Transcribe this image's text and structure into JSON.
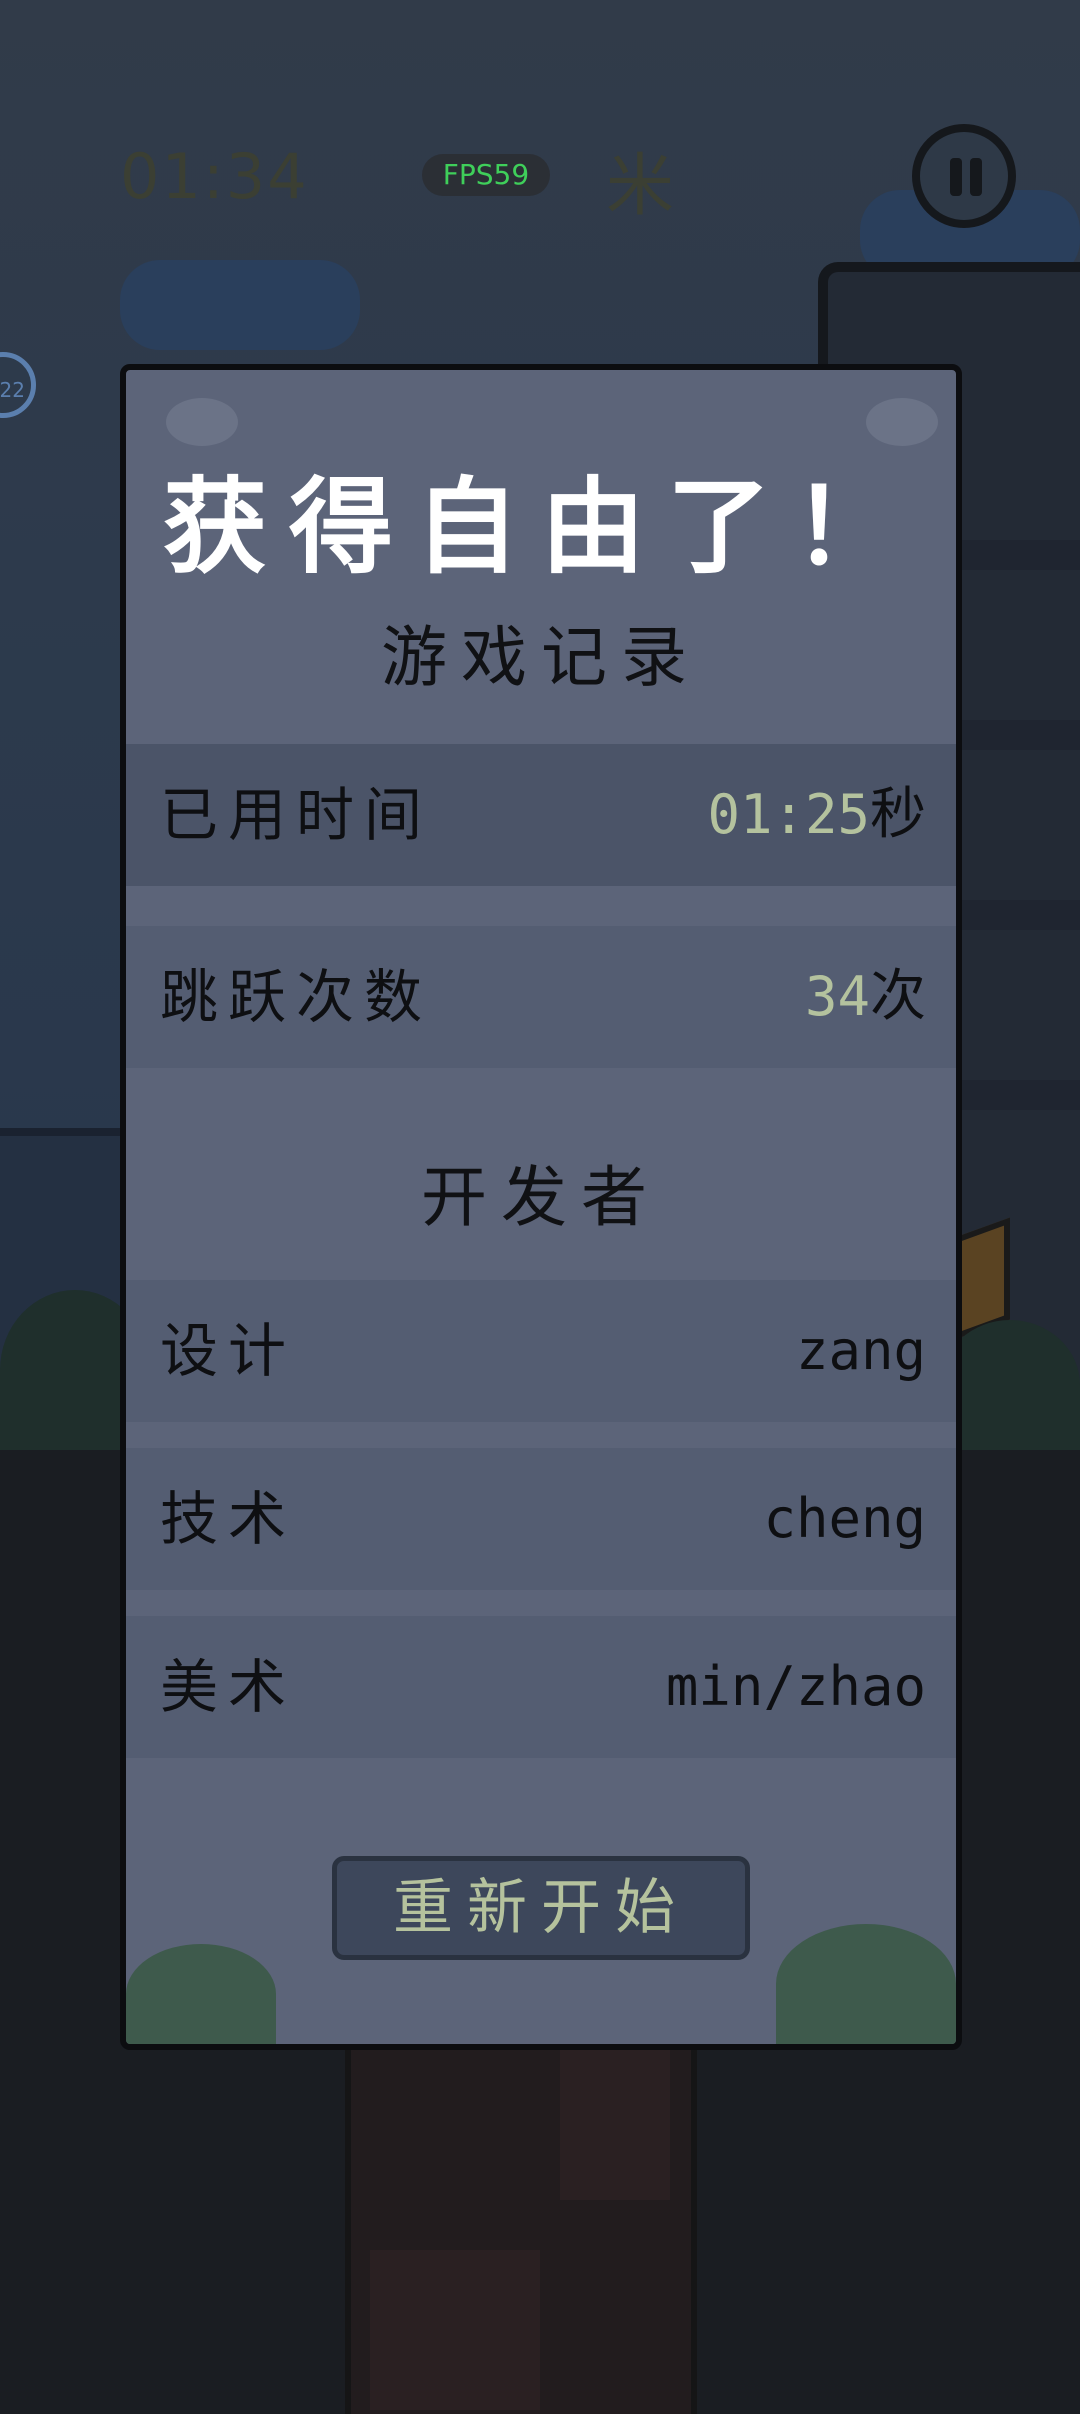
{
  "hud": {
    "time": "01:34",
    "distance": "米",
    "fps": "FPS59",
    "side_badge": "22"
  },
  "dialog": {
    "title": "获得自由了！",
    "record_section": "游戏记录",
    "records": [
      {
        "label": "已用时间",
        "value": "01:25",
        "unit": "秒"
      },
      {
        "label": "跳跃次数",
        "value": "34",
        "unit": "次"
      }
    ],
    "developer_section": "开发者",
    "developers": [
      {
        "role": "设计",
        "name": "zang"
      },
      {
        "role": "技术",
        "name": "cheng"
      },
      {
        "role": "美术",
        "name": "min/zhao"
      }
    ],
    "restart_label": "重新开始"
  },
  "colors": {
    "dialog_bg": "#5c6479",
    "highlight_number": "#b4c29e",
    "fps_text": "#3fcf5a",
    "title_text": "#ffffff"
  }
}
